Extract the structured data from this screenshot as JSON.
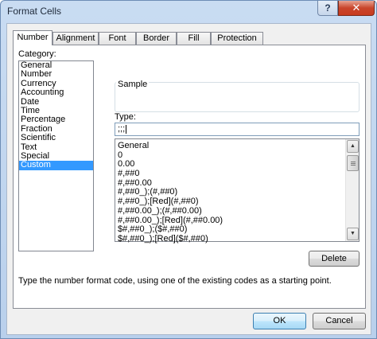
{
  "window": {
    "title": "Format Cells",
    "help_label": "?",
    "close_label": "✕"
  },
  "tabs": [
    {
      "label": "Number",
      "active": true
    },
    {
      "label": "Alignment",
      "active": false
    },
    {
      "label": "Font",
      "active": false
    },
    {
      "label": "Border",
      "active": false
    },
    {
      "label": "Fill",
      "active": false
    },
    {
      "label": "Protection",
      "active": false
    }
  ],
  "category": {
    "label": "Category:",
    "items": [
      "General",
      "Number",
      "Currency",
      "Accounting",
      "Date",
      "Time",
      "Percentage",
      "Fraction",
      "Scientific",
      "Text",
      "Special",
      "Custom"
    ],
    "selected": "Custom"
  },
  "sample": {
    "label": "Sample"
  },
  "type": {
    "label": "Type:",
    "value": ";;;",
    "formats": [
      "General",
      "0",
      "0.00",
      "#,##0",
      "#,##0.00",
      "#,##0_);(#,##0)",
      "#,##0_);[Red](#,##0)",
      "#,##0.00_);(#,##0.00)",
      "#,##0.00_);[Red](#,##0.00)",
      "$#,##0_);($#,##0)",
      "$#,##0_);[Red]($#,##0)"
    ]
  },
  "buttons": {
    "delete": "Delete",
    "ok": "OK",
    "cancel": "Cancel"
  },
  "hint": "Type the number format code, using one of the existing codes as a starting point."
}
